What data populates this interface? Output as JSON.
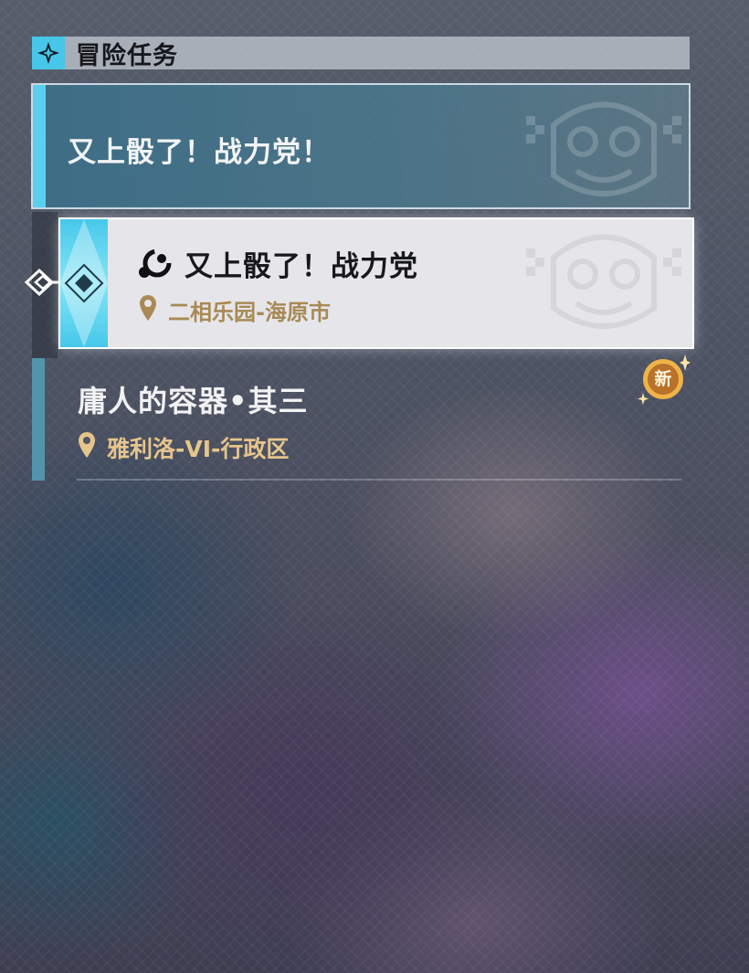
{
  "header": {
    "title": "冒险任务",
    "icon": "sparkle-star-icon"
  },
  "group": {
    "title": "又上骰了！战力党！",
    "watermark": "mascot-emblem"
  },
  "selected_quest": {
    "type_icon": "commission-icon",
    "title": "又上骰了！战力党",
    "location_icon": "location-pin-icon",
    "location": "二相乐园-海原市"
  },
  "quests": [
    {
      "title": "庸人的容器•其三",
      "location": "雅利洛-VI-行政区",
      "badge": "新"
    }
  ],
  "colors": {
    "accent": "#47c6ea",
    "location_selected": "#a88a55",
    "location": "#e6c58c",
    "badge": "#e7a53c"
  }
}
